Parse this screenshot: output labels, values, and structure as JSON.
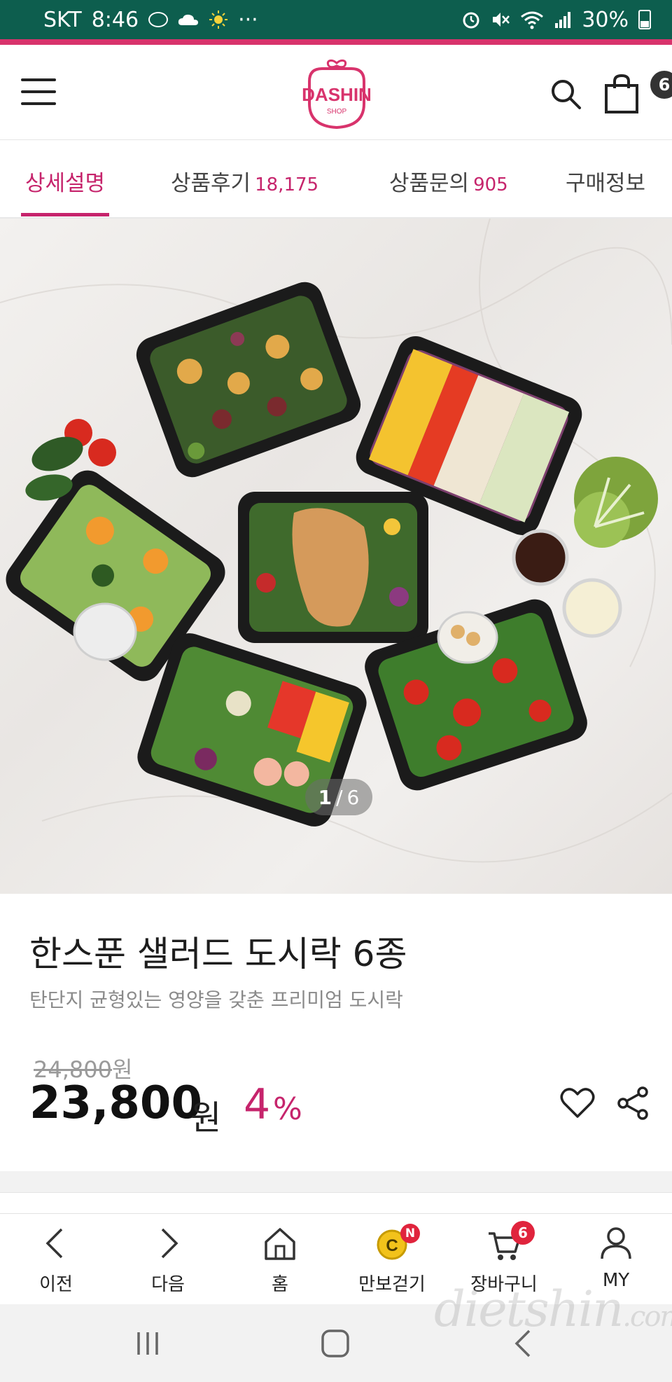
{
  "status_bar": {
    "carrier": "SKT",
    "time": "8:46",
    "dots": "···",
    "battery": "30%"
  },
  "header": {
    "logo_text": "DASHIN",
    "logo_sub": "SHOP",
    "cart_count": "6"
  },
  "tabs": [
    {
      "label": "상세설명",
      "count": ""
    },
    {
      "label": "상품후기",
      "count": "18,175"
    },
    {
      "label": "상품문의",
      "count": "905"
    },
    {
      "label": "구매정보",
      "count": ""
    }
  ],
  "hero": {
    "pager_current": "1",
    "pager_sep": "/",
    "pager_total": "6"
  },
  "product": {
    "title": "한스푼 샐러드 도시락 6종",
    "subtitle": "탄단지 균형있는 영양을 갖춘 프리미엄 도시락",
    "original_price": "24,800",
    "original_unit": "원",
    "price": "23,800",
    "price_unit": "원",
    "discount": "4",
    "discount_unit": "%"
  },
  "bottom_nav": [
    {
      "label": "이전",
      "icon": "chevron-left-icon"
    },
    {
      "label": "다음",
      "icon": "chevron-right-icon"
    },
    {
      "label": "홈",
      "icon": "home-icon"
    },
    {
      "label": "만보걷기",
      "icon": "coin-icon",
      "badge": "N"
    },
    {
      "label": "장바구니",
      "icon": "cart-icon",
      "badge": "6"
    },
    {
      "label": "MY",
      "icon": "user-icon"
    }
  ],
  "watermark": {
    "main": "dietshin",
    "suffix": ".com"
  },
  "colors": {
    "status_bar": "#0d5e4e",
    "accent": "#c6246c",
    "badge_red": "#e0243d"
  }
}
